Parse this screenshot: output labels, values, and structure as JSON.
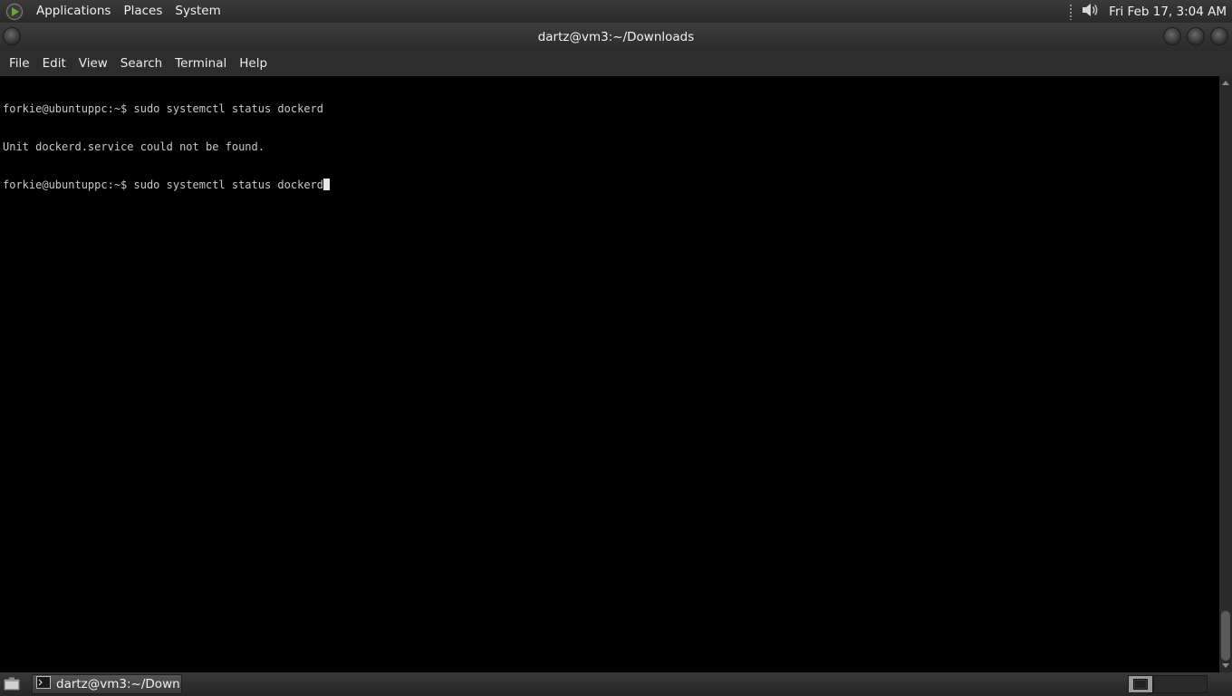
{
  "top_panel": {
    "menus": [
      "Applications",
      "Places",
      "System"
    ],
    "clock": "Fri Feb 17,  3:04 AM",
    "icons": {
      "logo": "menu-logo-icon",
      "volume": "speaker-icon"
    }
  },
  "window": {
    "title": "dartz@vm3:~/Downloads",
    "menu": [
      "File",
      "Edit",
      "View",
      "Search",
      "Terminal",
      "Help"
    ]
  },
  "terminal": {
    "lines": [
      "forkie@ubuntuppc:~$ sudo systemctl status dockerd",
      "Unit dockerd.service could not be found.",
      "forkie@ubuntuppc:~$ sudo systemctl status dockerd"
    ]
  },
  "taskbar": {
    "task_label": "dartz@vm3:~/Down..."
  },
  "colors": {
    "panel_bg": "#2e2e2e",
    "terminal_bg": "#000000",
    "terminal_fg": "#c8c8c8"
  }
}
